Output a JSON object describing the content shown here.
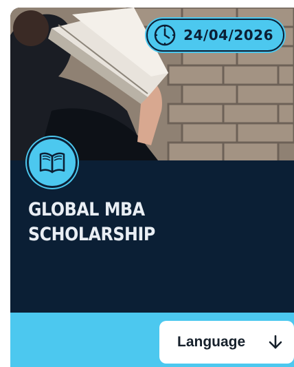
{
  "card": {
    "date": "24/04/2026",
    "title_line1": "GLOBAL MBA",
    "title_line2": "SCHOLARSHIP",
    "language_button_label": "Language"
  },
  "icons": {
    "date_icon": "clock-icon",
    "category_icon": "open-book-icon",
    "language_icon": "arrow-down-icon"
  },
  "colors": {
    "accent": "#4cc8ef",
    "card_background": "#0b1f35",
    "title_text": "#e9eef4",
    "button_background": "#ffffff"
  }
}
